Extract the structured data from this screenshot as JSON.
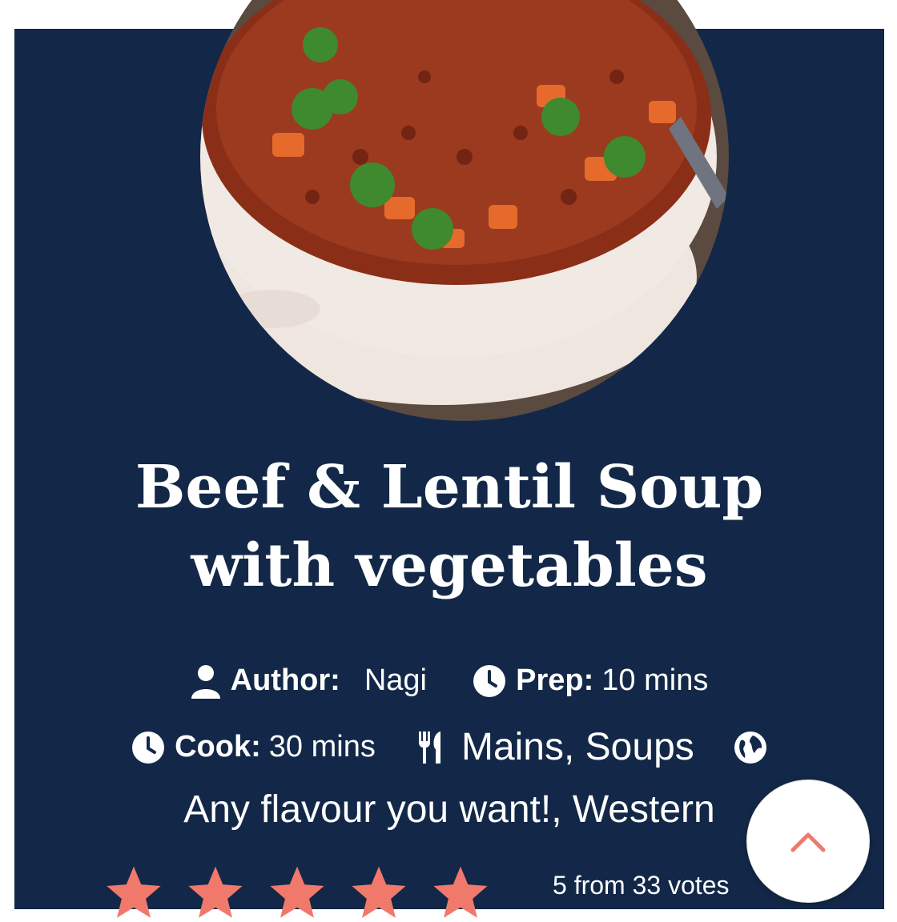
{
  "recipe": {
    "title_line1": "Beef & Lentil Soup",
    "title_line2": "with vegetables"
  },
  "meta": {
    "author_label": "Author:",
    "author_value": "Nagi",
    "prep_label": "Prep:",
    "prep_value": "10 mins",
    "cook_label": "Cook:",
    "cook_value": "30 mins",
    "course_value": "Mains, Soups",
    "cuisine_value": "Any flavour you want!, Western"
  },
  "rating": {
    "stars": 5,
    "max_stars": 5,
    "votes_text": "5 from 33 votes"
  },
  "icons": {
    "author": "user-icon",
    "prep": "clock-icon",
    "cook": "clock-icon",
    "course": "utensils-icon",
    "cuisine": "globe-icon",
    "scroll": "chevron-up-icon"
  },
  "colors": {
    "card_bg": "#132848",
    "star": "#f0796b",
    "chevron": "#f0796b"
  }
}
